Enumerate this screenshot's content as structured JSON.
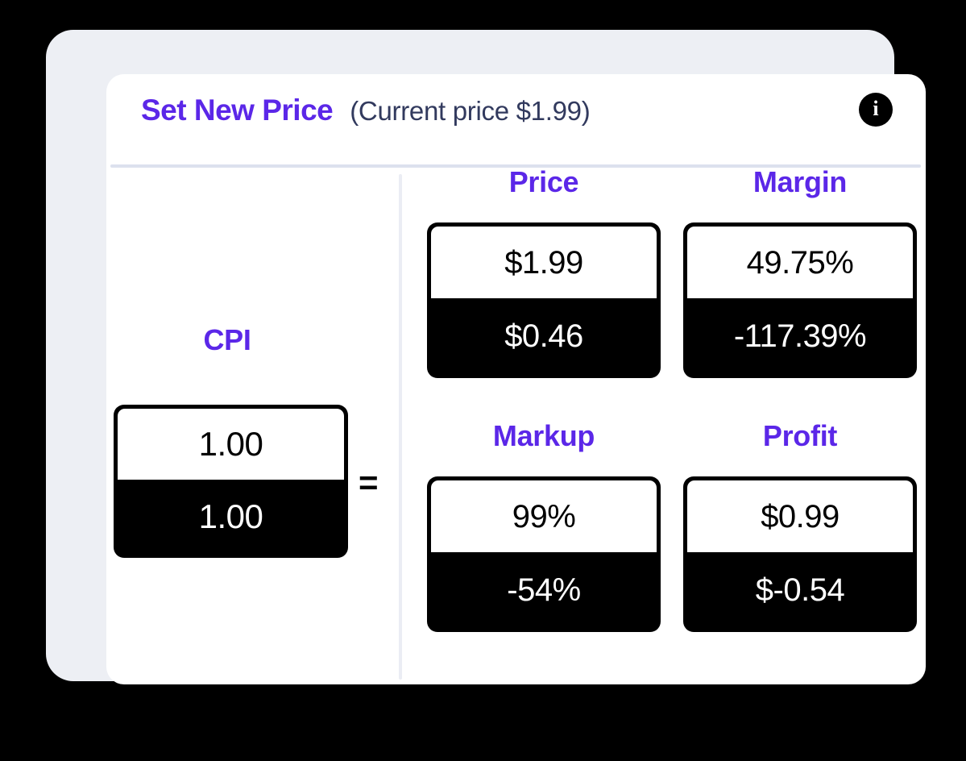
{
  "header": {
    "title": "Set New Price",
    "current_price_note": "(Current price $1.99)",
    "info_icon": "info-icon",
    "info_glyph": "i"
  },
  "colors": {
    "accent_purple": "#5B27E8",
    "note_navy": "#323A5E",
    "card_black": "#000000",
    "frame_gray": "#EDEFF4",
    "divider": "#DCE1EE",
    "page_background": "#000000"
  },
  "left_panel": {
    "label": "CPI",
    "top_value": "1.00",
    "bottom_value": "1.00",
    "equals_symbol": "="
  },
  "metrics": [
    {
      "label": "Price",
      "top_value": "$1.99",
      "bottom_value": "$0.46"
    },
    {
      "label": "Margin",
      "top_value": "49.75%",
      "bottom_value": "-117.39%"
    },
    {
      "label": "Markup",
      "top_value": "99%",
      "bottom_value": "-54%"
    },
    {
      "label": "Profit",
      "top_value": "$0.99",
      "bottom_value": "$-0.54"
    }
  ]
}
